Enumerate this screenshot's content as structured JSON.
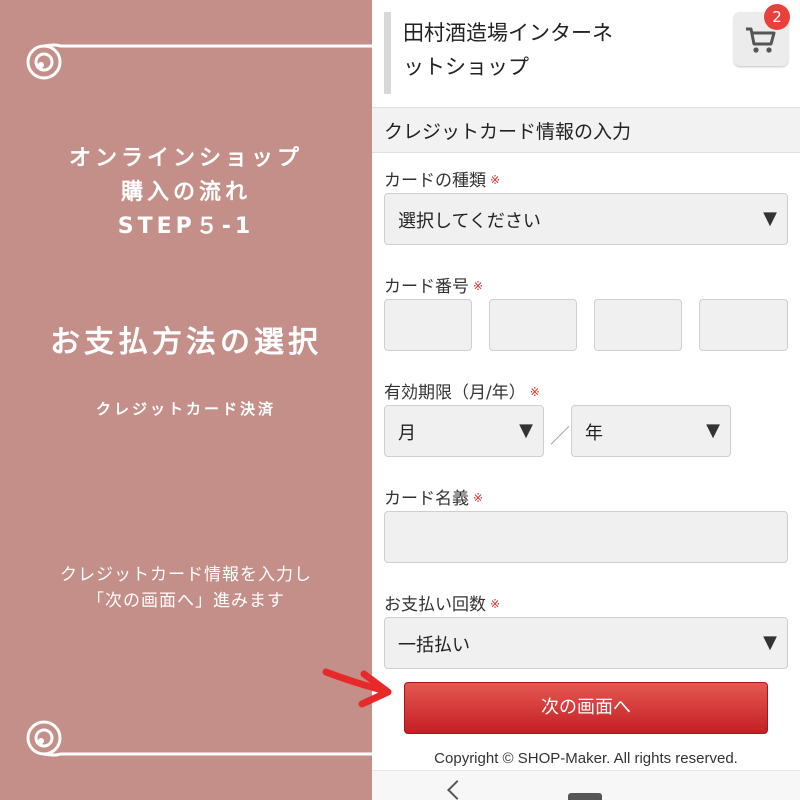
{
  "left": {
    "heading_line1": "オンラインショップ",
    "heading_line2": "購入の流れ",
    "heading_line3": "STEP５-1",
    "method": "お支払方法の選択",
    "sub": "クレジットカード決済",
    "desc_line1": "クレジットカード情報を入力し",
    "desc_line2": "「次の画面へ」進みます"
  },
  "header": {
    "shop_name_line1": "田村酒造場インターネ",
    "shop_name_line2": "ットショップ",
    "cart_count": "2"
  },
  "form": {
    "section_title": "クレジットカード情報の入力",
    "required_mark": "※",
    "card_type": {
      "label": "カードの種類",
      "value": "選択してください"
    },
    "card_number": {
      "label": "カード番号"
    },
    "expiry": {
      "label": "有効期限（月/年）",
      "month": "月",
      "year": "年",
      "separator": "／"
    },
    "card_name": {
      "label": "カード名義"
    },
    "installments": {
      "label": "お支払い回数",
      "value": "一括払い"
    },
    "dropdown_arrow": "▼",
    "next_button": "次の画面へ"
  },
  "footer": {
    "copyright": "Copyright © SHOP-Maker. All rights reserved."
  },
  "colors": {
    "left_bg": "#c58f89",
    "button_red": "#d33a3a",
    "badge_red": "#e8413c",
    "required_red": "#e03030"
  }
}
